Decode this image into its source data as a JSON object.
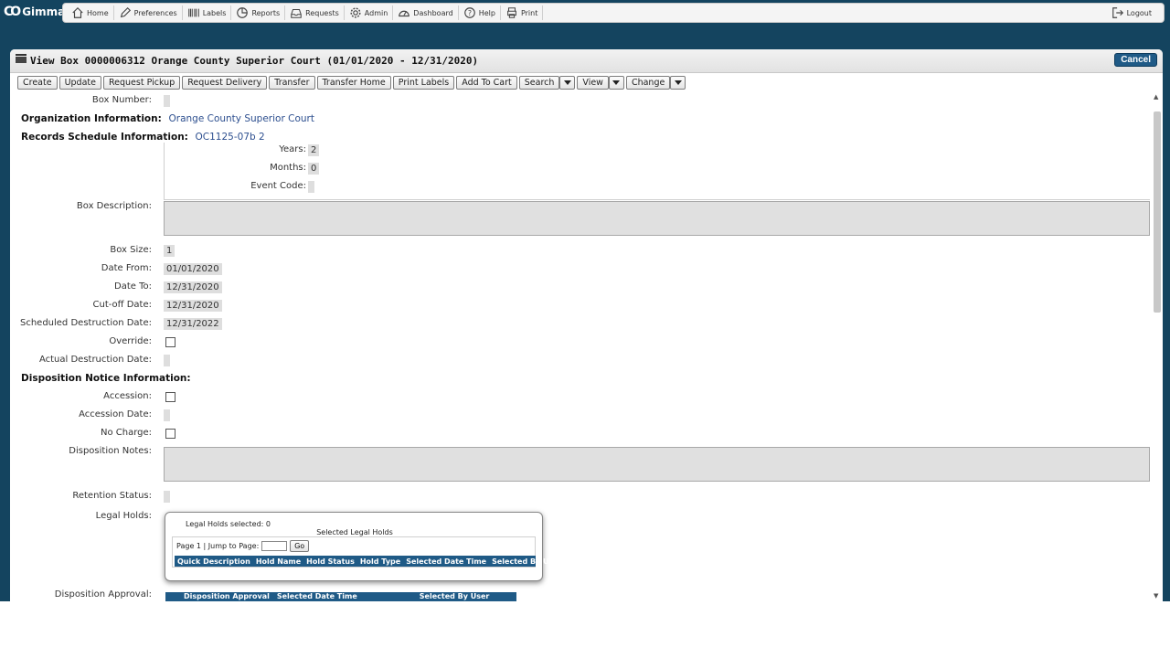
{
  "brand": {
    "logo_text": "Gimmal"
  },
  "nav": {
    "items": [
      {
        "label": "Home",
        "icon": "home-icon"
      },
      {
        "label": "Preferences",
        "icon": "pencil-icon"
      },
      {
        "label": "Labels",
        "icon": "barcode-icon"
      },
      {
        "label": "Reports",
        "icon": "pie-chart-icon"
      },
      {
        "label": "Requests",
        "icon": "inbox-icon"
      },
      {
        "label": "Admin",
        "icon": "gear-icon"
      },
      {
        "label": "Dashboard",
        "icon": "gauge-icon"
      },
      {
        "label": "Help",
        "icon": "question-icon"
      },
      {
        "label": "Print",
        "icon": "printer-icon"
      }
    ],
    "logout_label": "Logout"
  },
  "panel": {
    "title": "View Box 0000006312 Orange County Superior Court (01/01/2020 - 12/31/2020)",
    "cancel_label": "Cancel"
  },
  "toolbar": {
    "create": "Create",
    "update": "Update",
    "request_pickup": "Request Pickup",
    "request_delivery": "Request Delivery",
    "transfer": "Transfer",
    "transfer_home": "Transfer Home",
    "print_labels": "Print Labels",
    "add_to_cart": "Add To Cart",
    "search": "Search",
    "view": "View",
    "change": "Change"
  },
  "form": {
    "box_number_label": "Box Number:",
    "box_number_value": "",
    "org_info_label": "Organization Information:",
    "org_info_value": "Orange County Superior Court",
    "records_schedule_label": "Records Schedule Information:",
    "records_schedule_value": "OC1125-07b 2",
    "years_label": "Years:",
    "years_value": "2",
    "months_label": "Months:",
    "months_value": "0",
    "event_code_label": "Event Code:",
    "event_code_value": "",
    "box_description_label": "Box Description:",
    "box_size_label": "Box Size:",
    "box_size_value": "1",
    "date_from_label": "Date From:",
    "date_from_value": "01/01/2020",
    "date_to_label": "Date To:",
    "date_to_value": "12/31/2020",
    "cutoff_label": "Cut-off Date:",
    "cutoff_value": "12/31/2020",
    "sched_destruction_label": "Scheduled Destruction Date:",
    "sched_destruction_value": "12/31/2022",
    "override_label": "Override:",
    "actual_destruction_label": "Actual Destruction Date:",
    "actual_destruction_value": "",
    "disposition_notice_label": "Disposition Notice Information:",
    "accession_label": "Accession:",
    "accession_date_label": "Accession Date:",
    "accession_date_value": "",
    "no_charge_label": "No Charge:",
    "disposition_notes_label": "Disposition Notes:",
    "retention_status_label": "Retention Status:",
    "retention_status_value": "",
    "legal_holds_label": "Legal Holds:",
    "disposition_approval_label": "Disposition Approval:"
  },
  "legal_holds": {
    "selected_count_text": "Legal Holds selected: 0",
    "table_title": "Selected Legal Holds",
    "page_text": "Page 1 | Jump to Page:",
    "go_label": "Go",
    "columns": [
      "Quick Description",
      "Hold Name",
      "Hold Status",
      "Hold Type",
      "Selected Date Time",
      "Selected By User"
    ]
  },
  "disposition_approval": {
    "columns": [
      "Disposition Approval",
      "Selected Date Time",
      "Selected By User"
    ]
  }
}
